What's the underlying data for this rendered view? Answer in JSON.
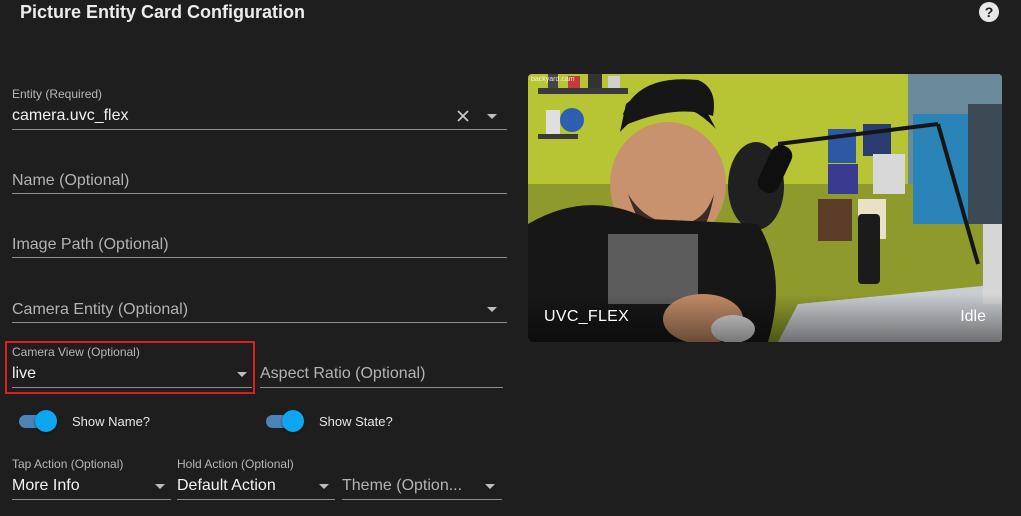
{
  "header": {
    "title": "Picture Entity Card Configuration",
    "help_icon": "question-circle-icon"
  },
  "form": {
    "entity": {
      "label": "Entity (Required)",
      "value": "camera.uvc_flex"
    },
    "name": {
      "placeholder": "Name (Optional)"
    },
    "image_path": {
      "placeholder": "Image Path (Optional)"
    },
    "camera_entity": {
      "placeholder": "Camera Entity (Optional)"
    },
    "camera_view": {
      "label": "Camera View (Optional)",
      "value": "live"
    },
    "aspect_ratio": {
      "placeholder": "Aspect Ratio (Optional)"
    },
    "show_name": {
      "label": "Show Name?",
      "checked": true
    },
    "show_state": {
      "label": "Show State?",
      "checked": true
    },
    "tap_action": {
      "label": "Tap Action (Optional)",
      "value": "More Info"
    },
    "hold_action": {
      "label": "Hold Action (Optional)",
      "value": "Default Action"
    },
    "theme": {
      "placeholder": "Theme (Option..."
    }
  },
  "preview": {
    "entity_name": "UVC_FLEX",
    "state": "Idle",
    "watermark": "backyard.cam"
  },
  "colors": {
    "background": "#1e1e1e",
    "toggle_accent": "#0ea5f1",
    "highlight_border": "#d9201c"
  }
}
